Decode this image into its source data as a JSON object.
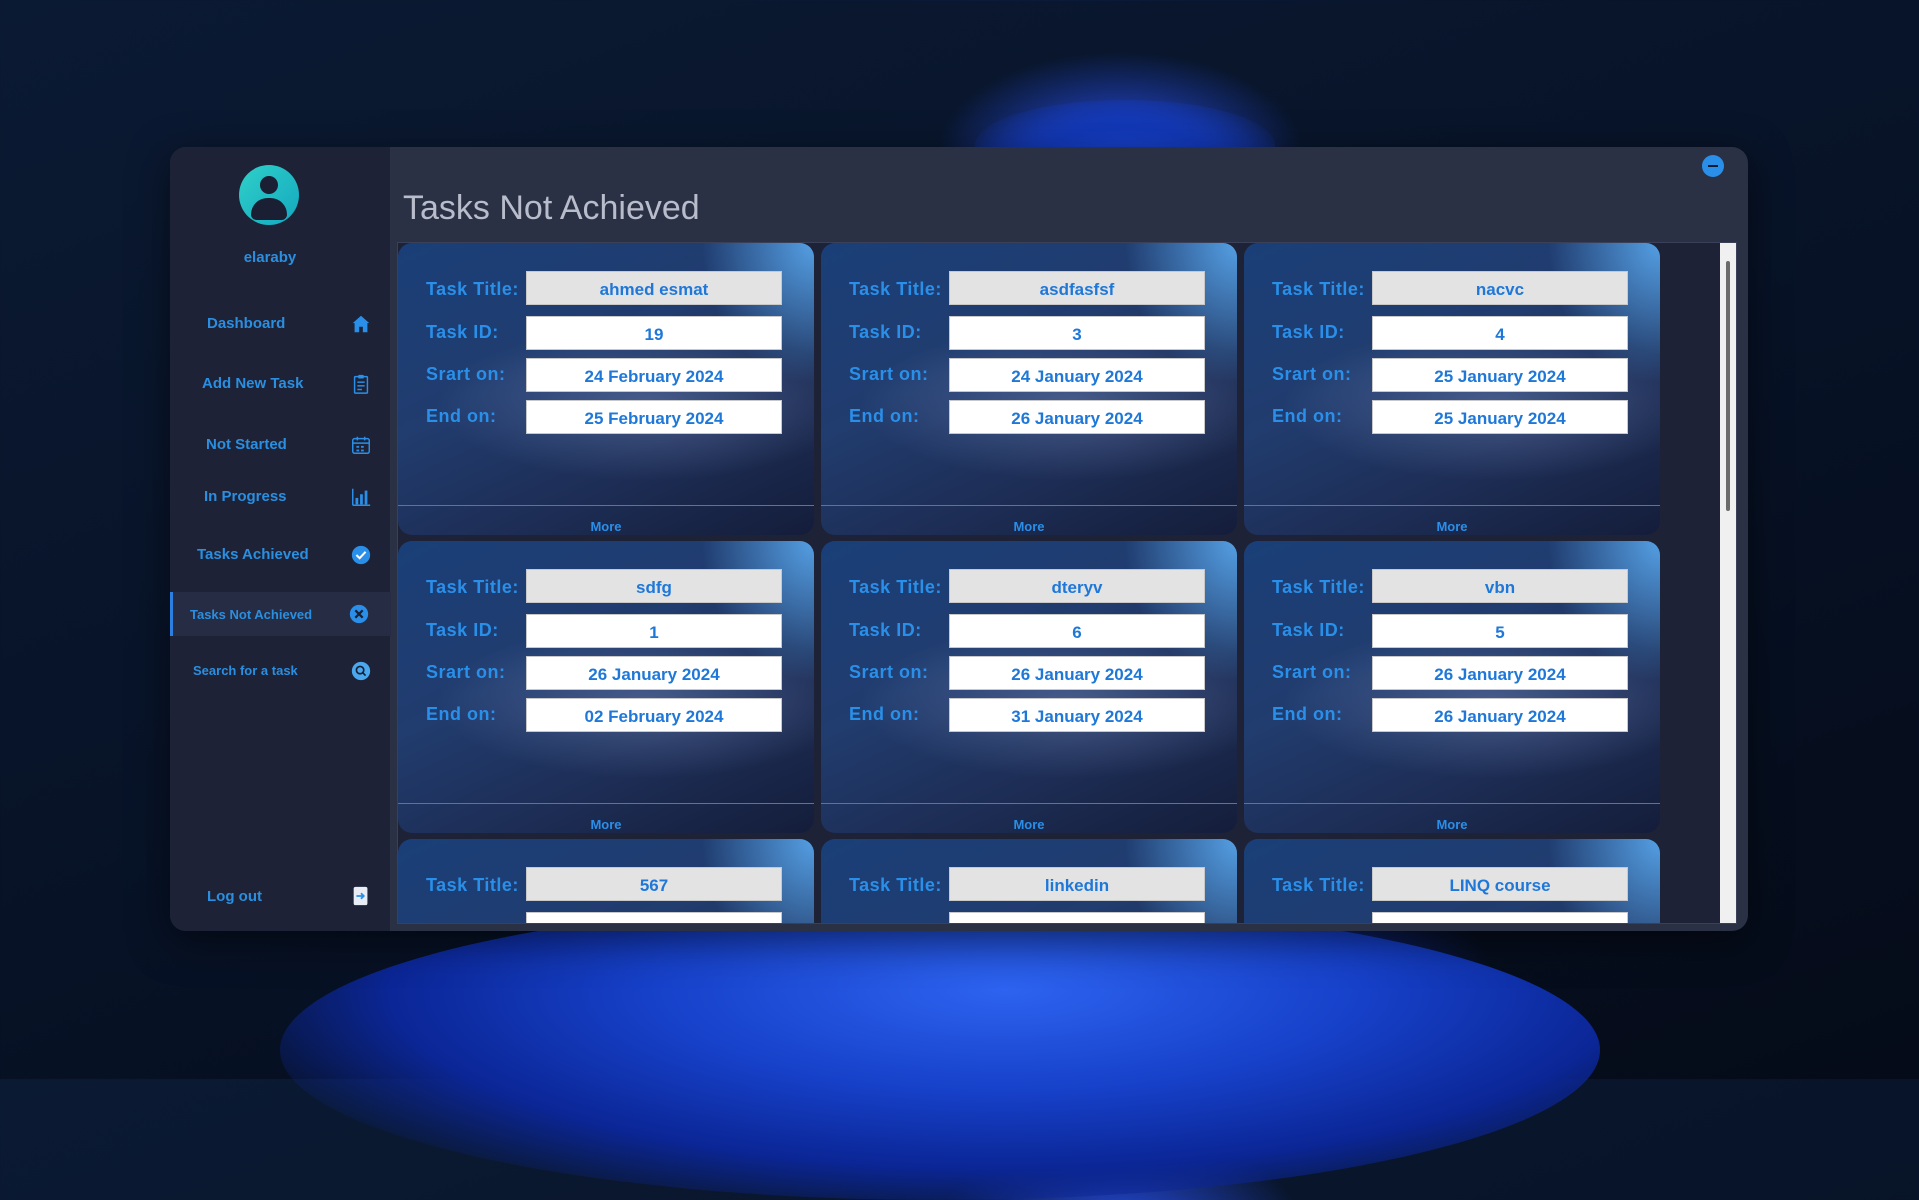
{
  "sidebar": {
    "username": "elaraby",
    "items": [
      {
        "label": "Dashboard"
      },
      {
        "label": "Add New Task"
      },
      {
        "label": "Not Started"
      },
      {
        "label": "In Progress"
      },
      {
        "label": "Tasks Achieved"
      },
      {
        "label": "Tasks Not Achieved"
      },
      {
        "label": "Search for a task"
      }
    ],
    "logout_label": "Log out"
  },
  "main": {
    "title": "Tasks Not Achieved"
  },
  "labels": {
    "task_title": "Task Title:",
    "task_id": "Task ID:",
    "start": "Srart on:",
    "end": "End on:",
    "more": "More"
  },
  "cards": [
    {
      "title": "ahmed esmat",
      "id": "19",
      "start": "24 February 2024",
      "end": "25 February 2024"
    },
    {
      "title": "asdfasfsf",
      "id": "3",
      "start": "24 January 2024",
      "end": "26 January 2024"
    },
    {
      "title": "nacvc",
      "id": "4",
      "start": "25 January 2024",
      "end": "25 January 2024"
    },
    {
      "title": "sdfg",
      "id": "1",
      "start": "26 January 2024",
      "end": "02 February 2024"
    },
    {
      "title": "dteryv",
      "id": "6",
      "start": "26 January 2024",
      "end": "31 January 2024"
    },
    {
      "title": "vbn",
      "id": "5",
      "start": "26 January 2024",
      "end": "26 January 2024"
    },
    {
      "title": "567"
    },
    {
      "title": "linkedin"
    },
    {
      "title": "LINQ course"
    }
  ],
  "colors": {
    "accent": "#2a8fe8",
    "sidebar_bg": "#1e2236",
    "window_bg": "#2b3145"
  }
}
